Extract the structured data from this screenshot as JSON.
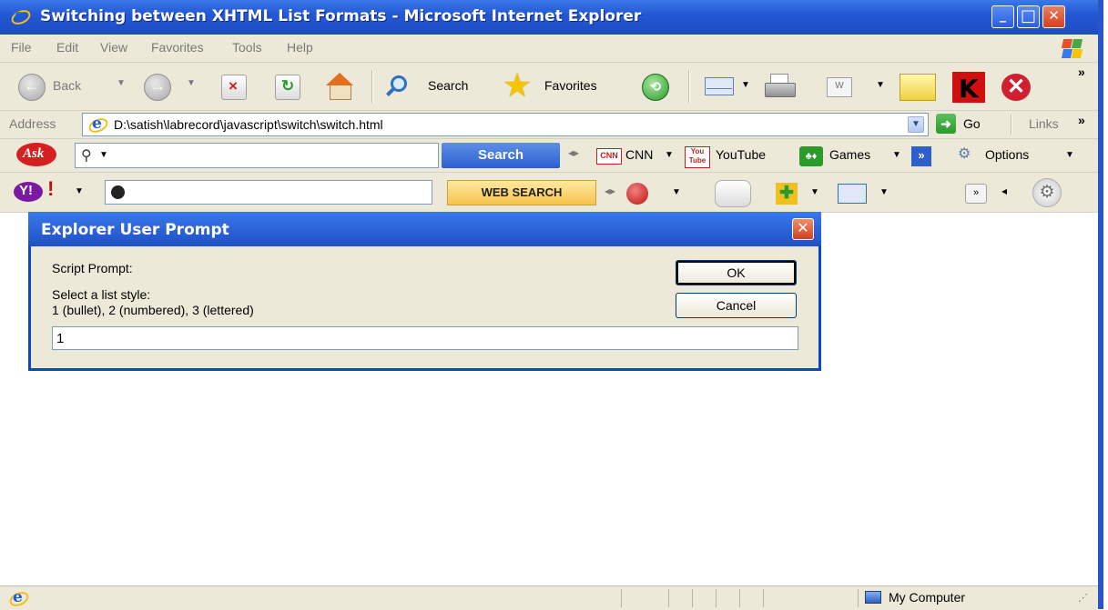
{
  "window": {
    "title": "Switching between XHTML List Formats - Microsoft Internet Explorer",
    "controls": {
      "minimize": "_",
      "maximize": "□",
      "close": "✕"
    }
  },
  "menu": {
    "items": [
      "File",
      "Edit",
      "View",
      "Favorites",
      "Tools",
      "Help"
    ]
  },
  "toolbar": {
    "back_label": "Back",
    "search_label": "Search",
    "favorites_label": "Favorites",
    "chevron": "»"
  },
  "address": {
    "label": "Address",
    "url": "D:\\satish\\labrecord\\javascript\\switch\\switch.html",
    "go_label": "Go",
    "links_label": "Links",
    "chevron": "»"
  },
  "ask_toolbar": {
    "logo": "Ask",
    "search_button": "Search",
    "cnn_label": "CNN",
    "youtube_label": "YouTube",
    "games_label": "Games",
    "options_label": "Options",
    "more": "»"
  },
  "yahoo_toolbar": {
    "logo": "Y!",
    "search_button": "WEB SEARCH",
    "more": "»"
  },
  "dialog": {
    "title": "Explorer User Prompt",
    "script_prompt_label": "Script Prompt:",
    "message_line1": "Select a list style:",
    "message_line2": "1 (bullet), 2 (numbered), 3 (lettered)",
    "input_value": "1",
    "ok_label": "OK",
    "cancel_label": "Cancel"
  },
  "status": {
    "zone_label": "My Computer"
  },
  "colors": {
    "xp_blue": "#2458d4",
    "chrome": "#ece9d8",
    "close_red": "#d04020"
  }
}
